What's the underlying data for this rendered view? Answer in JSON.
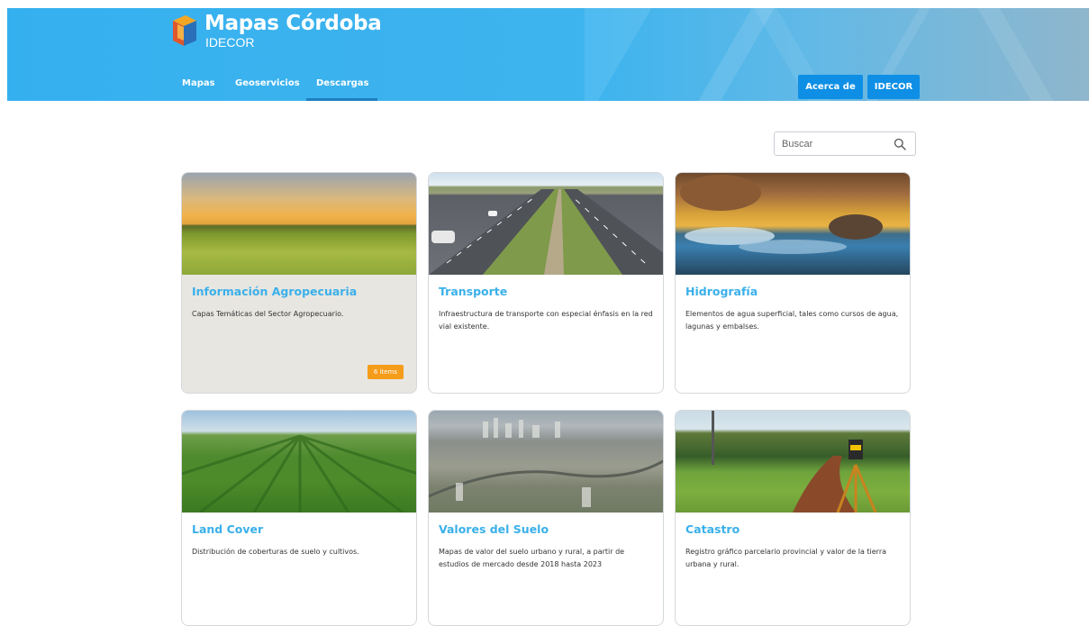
{
  "header": {
    "brand_title": "Mapas Córdoba",
    "brand_subtitle": "IDECOR",
    "nav": [
      {
        "label": "Mapas"
      },
      {
        "label": "Geoservicios"
      },
      {
        "label": "Descargas",
        "active": true
      }
    ],
    "buttons": {
      "about_label": "Acerca de",
      "idecor_label": "IDECOR"
    }
  },
  "search": {
    "placeholder": "Buscar",
    "value": ""
  },
  "cards": [
    {
      "title": "Información Agropecuaria",
      "description": "Capas Temáticas del Sector Agropecuario.",
      "badge": "6 items",
      "image": "sunset-crop-field-photo"
    },
    {
      "title": "Transporte",
      "description": "Infraestructura de transporte con especial énfasis en la red vial existente.",
      "image": "highway-photo"
    },
    {
      "title": "Hidrografía",
      "description": "Elementos de agua superficial, tales como cursos de agua, lagunas y embalses.",
      "image": "river-rocks-photo"
    },
    {
      "title": "Land Cover",
      "description": "Distribución de coberturas de suelo y cultivos.",
      "image": "crop-rows-photo"
    },
    {
      "title": "Valores del Suelo",
      "description": "Mapas de valor del suelo urbano y rural, a partir de estudios de mercado desde 2018 hasta 2023",
      "image": "aerial-city-photo"
    },
    {
      "title": "Catastro",
      "description": "Registro gráfico parcelario provincial y valor de la tierra urbana y rural.",
      "image": "surveying-instrument-photo"
    }
  ],
  "colors": {
    "header_blue": "#35b0ef",
    "button_blue": "#0e8fe5",
    "title_blue": "#3ab0ea",
    "badge_orange": "#f59c1a"
  }
}
